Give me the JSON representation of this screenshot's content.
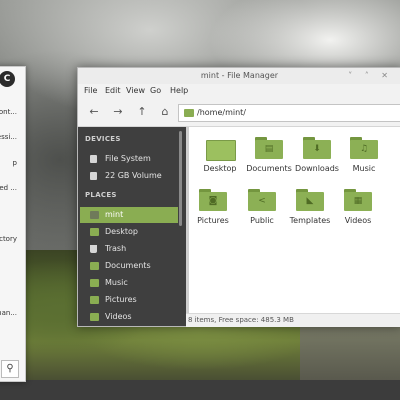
{
  "menu": {
    "user_initial": "C",
    "items": [
      "cont...",
      "essi...",
      "p",
      "led ...",
      "ctory",
      "nan..."
    ],
    "search_icon": "search-icon"
  },
  "window": {
    "title": "mint - File Manager",
    "controls": "˅ ˄ ✕"
  },
  "menubar": {
    "file": "File",
    "edit": "Edit",
    "view": "View",
    "go": "Go",
    "help": "Help"
  },
  "toolbar": {
    "back": "←",
    "forward": "→",
    "up": "↑",
    "home": "⌂",
    "location": "/home/mint/"
  },
  "sidebar": {
    "devices_heading": "DEVICES",
    "places_heading": "PLACES",
    "devices": [
      {
        "label": "File System"
      },
      {
        "label": "22 GB Volume"
      }
    ],
    "places": [
      {
        "label": "mint"
      },
      {
        "label": "Desktop"
      },
      {
        "label": "Trash"
      },
      {
        "label": "Documents"
      },
      {
        "label": "Music"
      },
      {
        "label": "Pictures"
      },
      {
        "label": "Videos"
      }
    ]
  },
  "files": [
    {
      "label": "Desktop",
      "glyph": ""
    },
    {
      "label": "Documents",
      "glyph": "▤"
    },
    {
      "label": "Downloads",
      "glyph": "⬇"
    },
    {
      "label": "Music",
      "glyph": "♫"
    },
    {
      "label": "Pictures",
      "glyph": "◙"
    },
    {
      "label": "Public",
      "glyph": "<"
    },
    {
      "label": "Templates",
      "glyph": "◣"
    },
    {
      "label": "Videos",
      "glyph": "▦"
    }
  ],
  "status": {
    "text": "8 items, Free space: 485.3 MB"
  },
  "colors": {
    "accent": "#8aad52",
    "sidebar_bg": "#3f3f3f"
  }
}
